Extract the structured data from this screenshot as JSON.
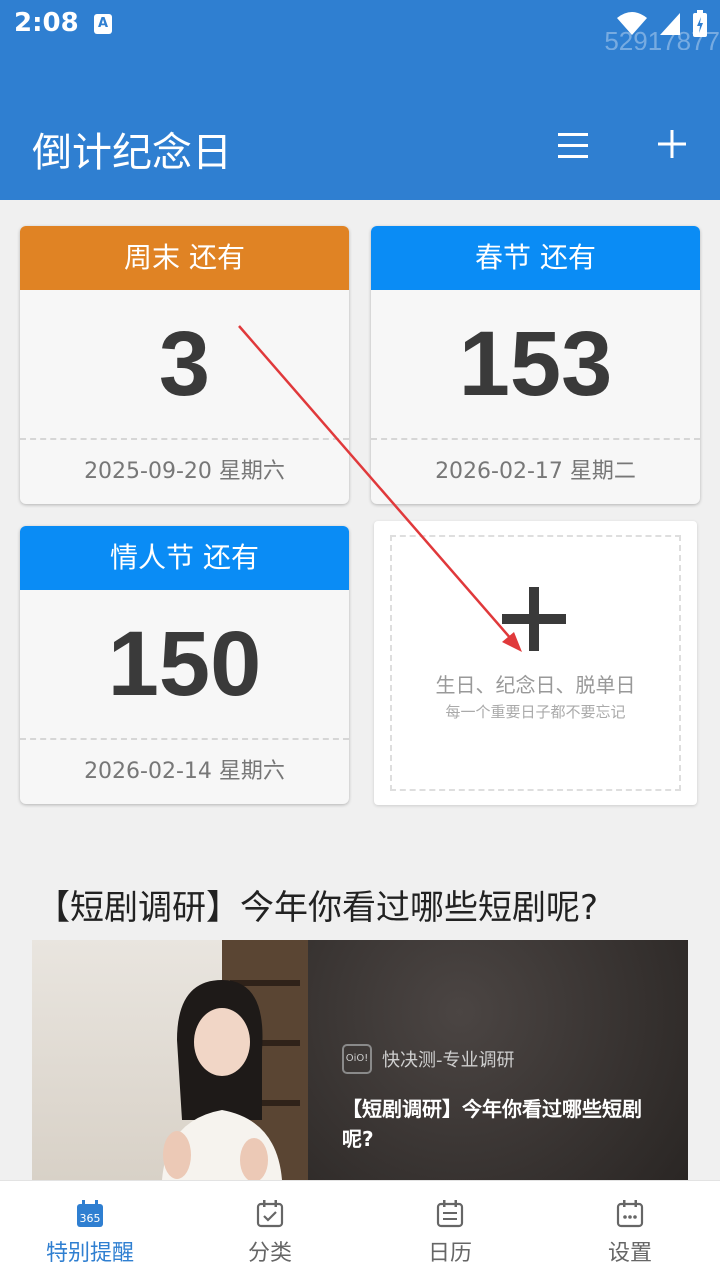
{
  "status_bar": {
    "time": "2:08",
    "a_icon": "A",
    "watermark": "52917877",
    "icons": [
      "wifi-icon",
      "signal-icon",
      "battery-icon"
    ]
  },
  "app_bar": {
    "title": "倒计纪念日",
    "color": "#2f7fd1"
  },
  "cards": [
    {
      "header": "周末 还有",
      "count": "3",
      "date": "2025-09-20 星期六",
      "color": "#e08324"
    },
    {
      "header": "春节 还有",
      "count": "153",
      "date": "2026-02-17 星期二",
      "color": "#0a8cf5"
    },
    {
      "header": "情人节 还有",
      "count": "150",
      "date": "2026-02-14 星期六",
      "color": "#0a8cf5"
    }
  ],
  "add_card": {
    "line1": "生日、纪念日、脱单日",
    "line2": "每一个重要日子都不要忘记"
  },
  "survey": {
    "title": "【短剧调研】今年你看过哪些短剧呢?",
    "brand": "快决测-专业调研",
    "logo_text": "OiO!",
    "headline": "【短剧调研】今年你看过哪些短剧呢?"
  },
  "tabs": [
    {
      "label": "特别提醒",
      "icon": "calendar-365-icon",
      "badge": "365",
      "active": true
    },
    {
      "label": "分类",
      "icon": "calendar-check-icon",
      "active": false
    },
    {
      "label": "日历",
      "icon": "calendar-list-icon",
      "active": false
    },
    {
      "label": "设置",
      "icon": "calendar-dots-icon",
      "active": false
    }
  ],
  "accent": "#2f7fd1"
}
